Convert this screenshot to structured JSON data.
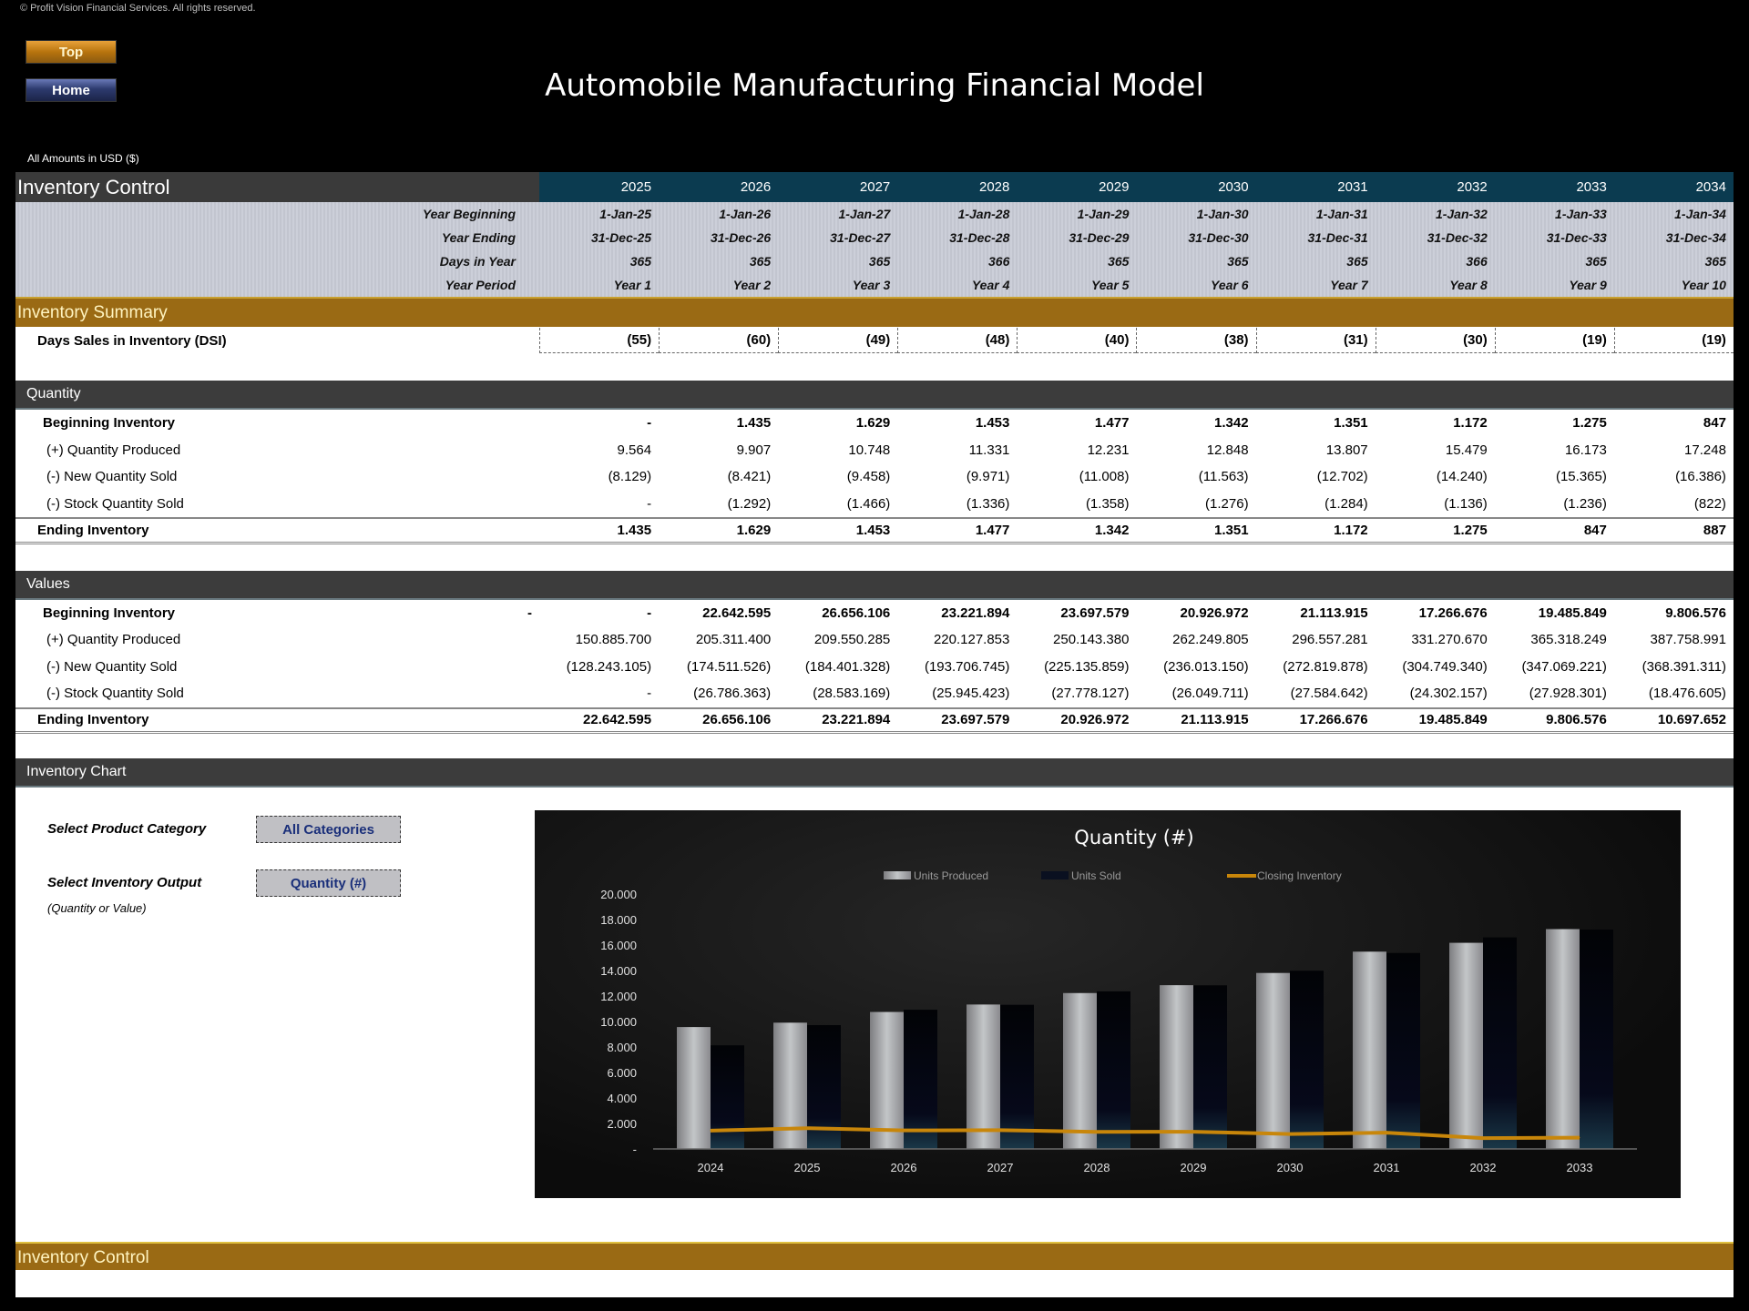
{
  "copyright": "© Profit Vision Financial Services. All rights reserved.",
  "nav": {
    "top_label": "Top",
    "home_label": "Home"
  },
  "title": "Automobile Manufacturing Financial Model",
  "amounts_note": "All Amounts in  USD ($)",
  "header": {
    "section_title": "Inventory Control",
    "years": [
      "2025",
      "2026",
      "2027",
      "2028",
      "2029",
      "2030",
      "2031",
      "2032",
      "2033",
      "2034"
    ]
  },
  "dates": {
    "rows": [
      {
        "label": "Year Beginning",
        "values": [
          "1-Jan-25",
          "1-Jan-26",
          "1-Jan-27",
          "1-Jan-28",
          "1-Jan-29",
          "1-Jan-30",
          "1-Jan-31",
          "1-Jan-32",
          "1-Jan-33",
          "1-Jan-34"
        ]
      },
      {
        "label": "Year Ending",
        "values": [
          "31-Dec-25",
          "31-Dec-26",
          "31-Dec-27",
          "31-Dec-28",
          "31-Dec-29",
          "31-Dec-30",
          "31-Dec-31",
          "31-Dec-32",
          "31-Dec-33",
          "31-Dec-34"
        ]
      },
      {
        "label": "Days in Year",
        "values": [
          "365",
          "365",
          "365",
          "366",
          "365",
          "365",
          "365",
          "366",
          "365",
          "365"
        ]
      },
      {
        "label": "Year Period",
        "values": [
          "Year 1",
          "Year 2",
          "Year 3",
          "Year 4",
          "Year 5",
          "Year 6",
          "Year 7",
          "Year 8",
          "Year 9",
          "Year 10"
        ]
      }
    ]
  },
  "summary": {
    "title": "Inventory Summary",
    "dsi": {
      "label": "Days Sales in Inventory (DSI)",
      "values": [
        "(55)",
        "(60)",
        "(49)",
        "(48)",
        "(40)",
        "(38)",
        "(31)",
        "(30)",
        "(19)",
        "(19)"
      ]
    }
  },
  "quantity": {
    "title": "Quantity",
    "rows": [
      {
        "label": "Beginning Inventory",
        "style": "bold",
        "values": [
          "-",
          "1.435",
          "1.629",
          "1.453",
          "1.477",
          "1.342",
          "1.351",
          "1.172",
          "1.275",
          "847"
        ]
      },
      {
        "label": "(+) Quantity Produced",
        "style": "sub",
        "values": [
          "9.564",
          "9.907",
          "10.748",
          "11.331",
          "12.231",
          "12.848",
          "13.807",
          "15.479",
          "16.173",
          "17.248"
        ]
      },
      {
        "label": "(-) New Quantity Sold",
        "style": "sub",
        "values": [
          "(8.129)",
          "(8.421)",
          "(9.458)",
          "(9.971)",
          "(11.008)",
          "(11.563)",
          "(12.702)",
          "(14.240)",
          "(15.365)",
          "(16.386)"
        ]
      },
      {
        "label": "(-) Stock Quantity Sold",
        "style": "sub",
        "values": [
          "-",
          "(1.292)",
          "(1.466)",
          "(1.336)",
          "(1.358)",
          "(1.276)",
          "(1.284)",
          "(1.136)",
          "(1.236)",
          "(822)"
        ]
      },
      {
        "label": "Ending Inventory",
        "style": "total",
        "values": [
          "1.435",
          "1.629",
          "1.453",
          "1.477",
          "1.342",
          "1.351",
          "1.172",
          "1.275",
          "847",
          "887"
        ]
      }
    ]
  },
  "values": {
    "title": "Values",
    "beginning_extra": "-",
    "rows": [
      {
        "label": "Beginning Inventory",
        "style": "bold",
        "values": [
          "-",
          "22.642.595",
          "26.656.106",
          "23.221.894",
          "23.697.579",
          "20.926.972",
          "21.113.915",
          "17.266.676",
          "19.485.849",
          "9.806.576"
        ]
      },
      {
        "label": "(+) Quantity Produced",
        "style": "sub",
        "values": [
          "150.885.700",
          "205.311.400",
          "209.550.285",
          "220.127.853",
          "250.143.380",
          "262.249.805",
          "296.557.281",
          "331.270.670",
          "365.318.249",
          "387.758.991"
        ]
      },
      {
        "label": "(-) New Quantity Sold",
        "style": "sub",
        "values": [
          "(128.243.105)",
          "(174.511.526)",
          "(184.401.328)",
          "(193.706.745)",
          "(225.135.859)",
          "(236.013.150)",
          "(272.819.878)",
          "(304.749.340)",
          "(347.069.221)",
          "(368.391.311)"
        ]
      },
      {
        "label": "(-) Stock Quantity Sold",
        "style": "sub",
        "values": [
          "-",
          "(26.786.363)",
          "(28.583.169)",
          "(25.945.423)",
          "(27.778.127)",
          "(26.049.711)",
          "(27.584.642)",
          "(24.302.157)",
          "(27.928.301)",
          "(18.476.605)"
        ]
      },
      {
        "label": "Ending Inventory",
        "style": "total",
        "values": [
          "22.642.595",
          "26.656.106",
          "23.221.894",
          "23.697.579",
          "20.926.972",
          "21.113.915",
          "17.266.676",
          "19.485.849",
          "9.806.576",
          "10.697.652"
        ]
      }
    ]
  },
  "chart_section": {
    "title": "Inventory Chart",
    "category_label": "Select Product Category",
    "category_value": "All Categories",
    "output_label": "Select Inventory Output",
    "output_sub": "(Quantity or Value)",
    "output_value": "Quantity (#)"
  },
  "chart_data": {
    "type": "bar",
    "title": "Quantity (#)",
    "categories": [
      "2024",
      "2025",
      "2026",
      "2027",
      "2028",
      "2029",
      "2030",
      "2031",
      "2032",
      "2033"
    ],
    "series": [
      {
        "name": "Units Produced",
        "type": "bar",
        "color": "#a8a8a8",
        "values": [
          9564,
          9907,
          10748,
          11331,
          12231,
          12848,
          13807,
          15479,
          16173,
          17248
        ]
      },
      {
        "name": "Units Sold",
        "type": "bar",
        "color": "#05080e",
        "values": [
          8129,
          9713,
          10924,
          11307,
          12366,
          12839,
          13986,
          15376,
          16601,
          17208
        ]
      },
      {
        "name": "Closing Inventory",
        "type": "line",
        "color": "#c8860a",
        "values": [
          1435,
          1629,
          1453,
          1477,
          1342,
          1351,
          1172,
          1275,
          847,
          887
        ]
      }
    ],
    "yticks": [
      "-",
      "2.000",
      "4.000",
      "6.000",
      "8.000",
      "10.000",
      "12.000",
      "14.000",
      "16.000",
      "18.000",
      "20.000"
    ],
    "ylim": [
      0,
      20000
    ],
    "xlabel": "",
    "ylabel": "",
    "legend": "top",
    "grid": false
  },
  "footer": {
    "band_title": "Inventory Control"
  }
}
